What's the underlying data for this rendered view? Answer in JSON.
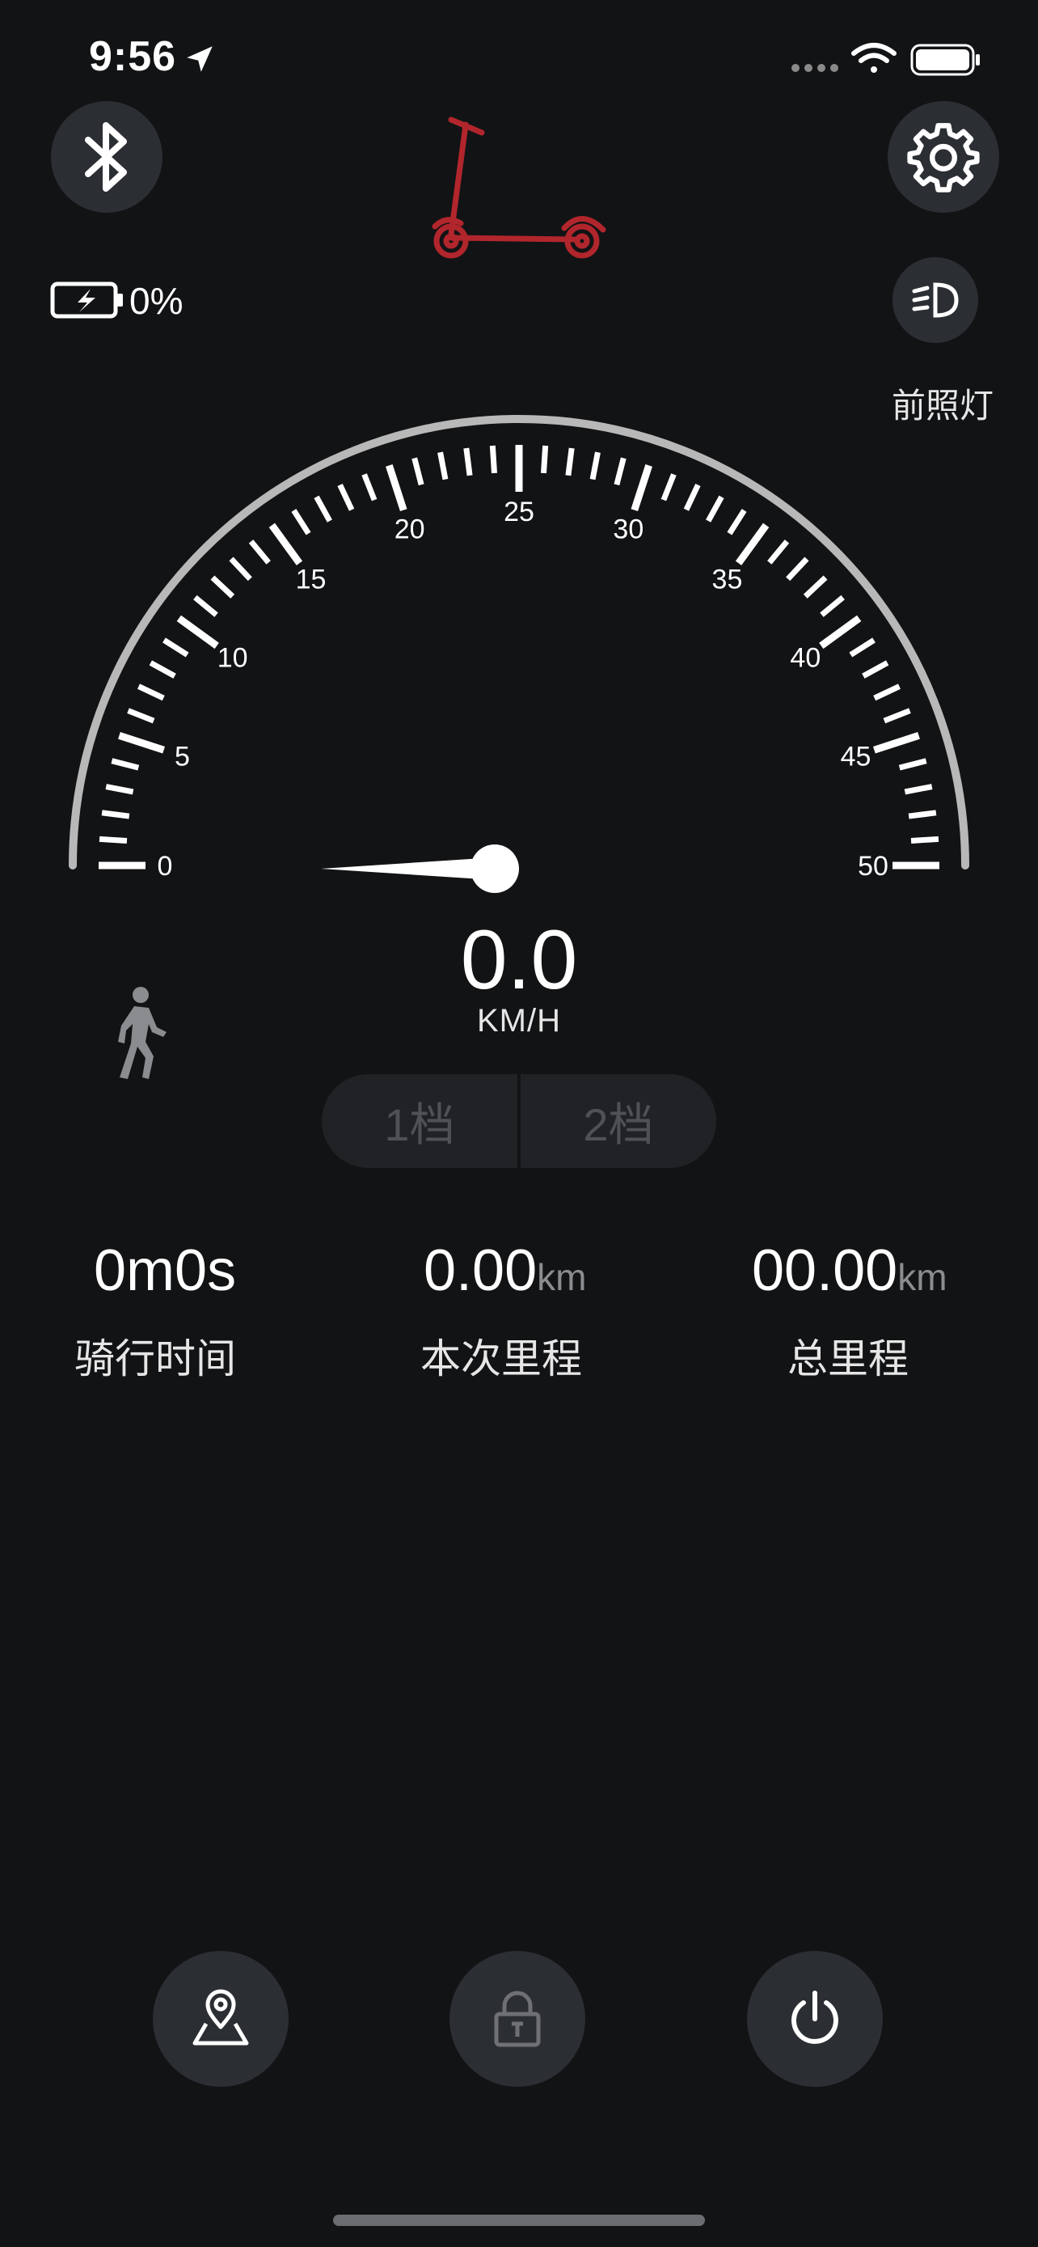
{
  "status_bar": {
    "time": "9:56",
    "icons": [
      "location-arrow-icon",
      "signal-dots-icon",
      "wifi-icon",
      "battery-full-icon"
    ]
  },
  "header": {
    "bluetooth_icon": "bluetooth-icon",
    "settings_icon": "gear-icon",
    "scooter_icon": "kick-scooter-icon",
    "scooter_color": "#b1262c"
  },
  "battery": {
    "icon": "battery-charging-icon",
    "level_text": "0%"
  },
  "headlight": {
    "icon": "headlight-icon",
    "label": "前照灯"
  },
  "speedometer": {
    "min": 0,
    "max": 50,
    "tick_labels": [
      "0",
      "5",
      "10",
      "15",
      "20",
      "25",
      "30",
      "35",
      "40",
      "45",
      "50"
    ],
    "current_speed": 0.0,
    "value_text": "0.0",
    "unit": "KM/H",
    "mode_icon": "walking-person-icon"
  },
  "gears": {
    "items": [
      {
        "label": "1档"
      },
      {
        "label": "2档"
      }
    ]
  },
  "stats": {
    "ride_time": {
      "value": "0m0s",
      "label": "骑行时间"
    },
    "trip": {
      "value": "0.00",
      "unit": "km",
      "label": "本次里程"
    },
    "total": {
      "value": "00.00",
      "unit": "km",
      "label": "总里程"
    }
  },
  "bottom_bar": {
    "map_icon": "map-pin-icon",
    "lock_icon": "lock-icon",
    "power_icon": "power-icon"
  },
  "colors": {
    "background": "#121315",
    "button_bg": "#2b2e33",
    "accent_red": "#b1262c",
    "disabled_text": "#4f5156"
  }
}
